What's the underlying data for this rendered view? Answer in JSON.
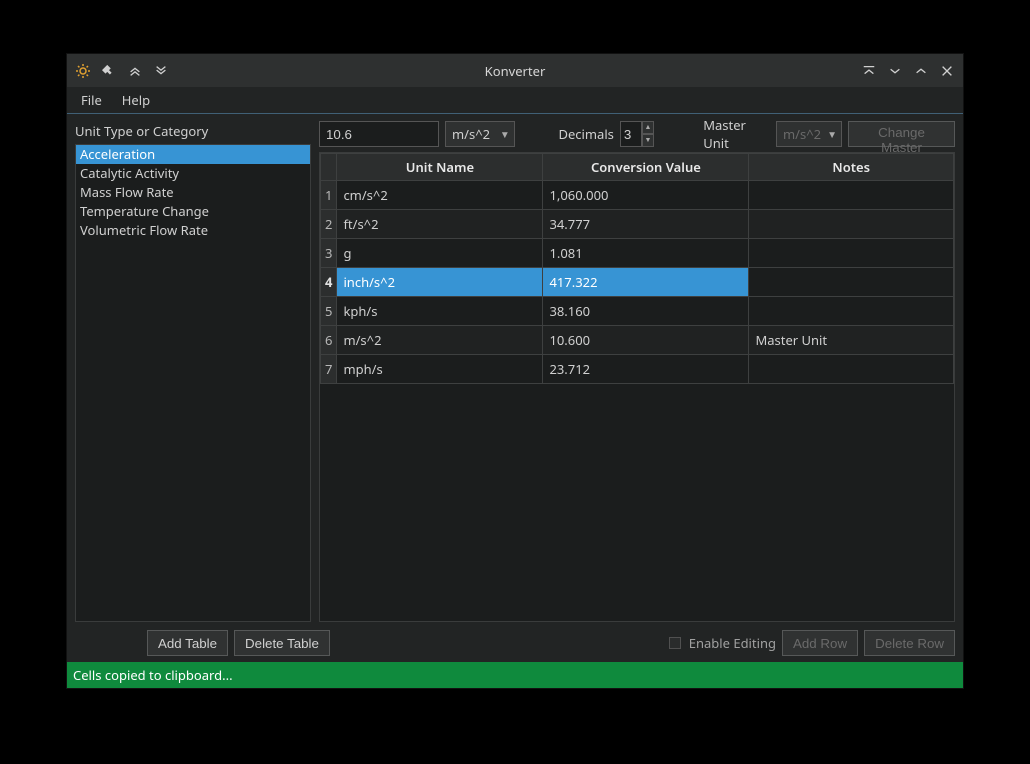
{
  "title": "Konverter",
  "menu": {
    "file": "File",
    "help": "Help"
  },
  "sidebar": {
    "label": "Unit Type or Category",
    "items": [
      "Acceleration",
      "Catalytic Activity",
      "Mass Flow Rate",
      "Temperature Change",
      "Volumetric Flow Rate"
    ],
    "selected_index": 0
  },
  "toolbar": {
    "value": "10.6",
    "unit_selected": "m/s^2",
    "decimals_label": "Decimals",
    "decimals_value": "3",
    "master_label": "Master Unit",
    "master_selected": "m/s^2",
    "change_master": "Change Master"
  },
  "table": {
    "columns": [
      "Unit Name",
      "Conversion Value",
      "Notes"
    ],
    "rows": [
      {
        "n": "1",
        "unit": "cm/s^2",
        "value": "1,060.000",
        "notes": ""
      },
      {
        "n": "2",
        "unit": "ft/s^2",
        "value": "34.777",
        "notes": ""
      },
      {
        "n": "3",
        "unit": "g",
        "value": "1.081",
        "notes": ""
      },
      {
        "n": "4",
        "unit": "inch/s^2",
        "value": "417.322",
        "notes": ""
      },
      {
        "n": "5",
        "unit": "kph/s",
        "value": "38.160",
        "notes": ""
      },
      {
        "n": "6",
        "unit": "m/s^2",
        "value": "10.600",
        "notes": "Master Unit"
      },
      {
        "n": "7",
        "unit": "mph/s",
        "value": "23.712",
        "notes": ""
      }
    ],
    "selected_index": 3
  },
  "bottom": {
    "add_table": "Add Table",
    "delete_table": "Delete Table",
    "enable_editing": "Enable Editing",
    "add_row": "Add Row",
    "delete_row": "Delete Row"
  },
  "status": "Cells copied to clipboard..."
}
